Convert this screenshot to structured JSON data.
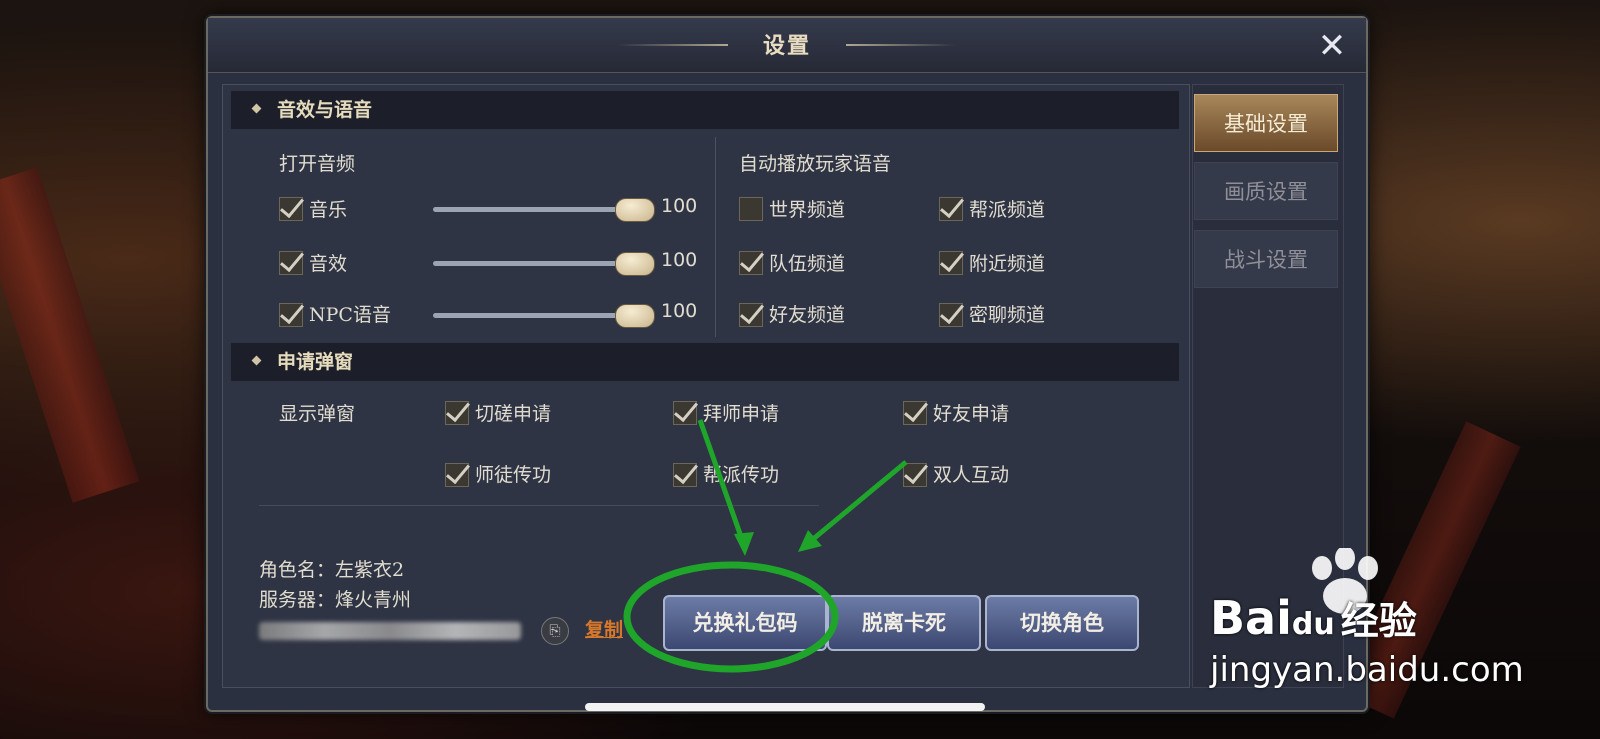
{
  "dialog": {
    "title": "设置"
  },
  "audio": {
    "section_title": "音效与语音",
    "open_audio_label": "打开音频",
    "items": [
      {
        "label": "音乐",
        "checked": true,
        "value": "100"
      },
      {
        "label": "音效",
        "checked": true,
        "value": "100"
      },
      {
        "label": "NPC语音",
        "checked": true,
        "value": "100"
      }
    ],
    "auto_play_label": "自动播放玩家语音",
    "channels": [
      {
        "label": "世界频道",
        "checked": false
      },
      {
        "label": "帮派频道",
        "checked": true
      },
      {
        "label": "队伍频道",
        "checked": true
      },
      {
        "label": "附近频道",
        "checked": true
      },
      {
        "label": "好友频道",
        "checked": true
      },
      {
        "label": "密聊频道",
        "checked": true
      }
    ]
  },
  "popup": {
    "section_title": "申请弹窗",
    "show_label": "显示弹窗",
    "items": [
      {
        "label": "切磋申请",
        "checked": true
      },
      {
        "label": "拜师申请",
        "checked": true
      },
      {
        "label": "好友申请",
        "checked": true
      },
      {
        "label": "师徒传功",
        "checked": true
      },
      {
        "label": "帮派传功",
        "checked": true
      },
      {
        "label": "双人互动",
        "checked": true
      }
    ]
  },
  "info": {
    "character_line": "角色名：左紫衣2",
    "server_line": "服务器：烽火青州",
    "copy_label": "复制"
  },
  "buttons": {
    "redeem": "兑换礼包码",
    "unstuck": "脱离卡死",
    "switch_role": "切换角色"
  },
  "tabs": [
    "基础设置",
    "画质设置",
    "战斗设置"
  ],
  "watermark": {
    "brand": "Bai",
    "brand_du": "du",
    "brand_cn": "经验",
    "url": "jingyan.baidu.com"
  },
  "colors": {
    "annotation": "#1fa52a",
    "accent_tab": "#a8875a"
  }
}
